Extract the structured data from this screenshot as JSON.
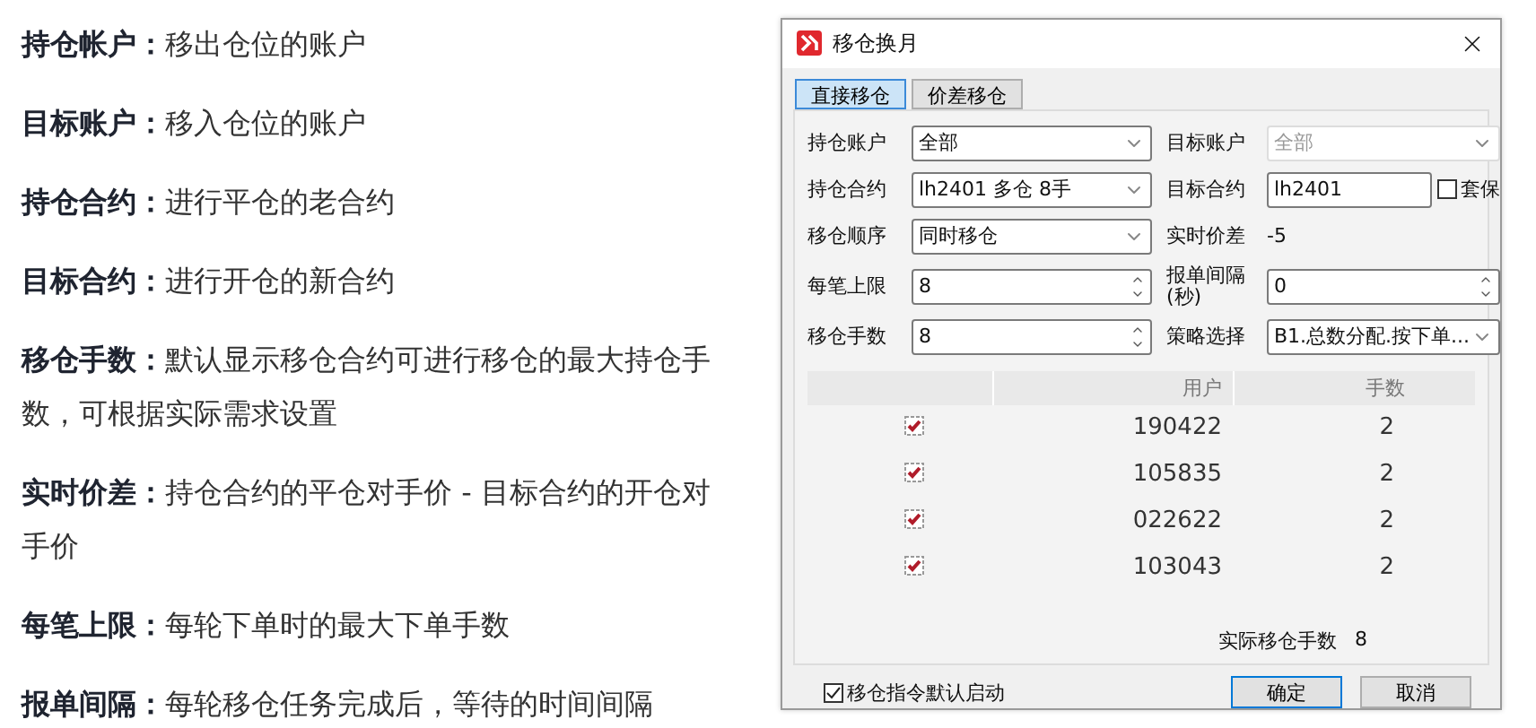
{
  "notes": [
    {
      "text": "**持仓帐户：**移出仓位的账户"
    },
    {
      "text": "**目标账户：**移入仓位的账户"
    },
    {
      "text": "**持仓合约：**进行平仓的老合约"
    },
    {
      "text": "**目标合约：**进行开仓的新合约"
    },
    {
      "text": "**移仓手数：**默认显示移仓合约可进行移仓的最大持仓手数，可根据实际需求设置"
    },
    {
      "text": "**实时价差：**持仓合约的平仓对手价 - 目标合约的开仓对手价"
    },
    {
      "text": "**每笔上限：**每轮下单时的最大下单手数"
    },
    {
      "text": "**报单间隔：**每轮移仓任务完成后，等待的时间间隔"
    }
  ],
  "dialog": {
    "title": "移仓换月",
    "tabs": [
      {
        "label": "直接移仓",
        "selected": true
      },
      {
        "label": "价差移仓",
        "selected": false
      }
    ],
    "fields": [
      {
        "label": "持仓账户",
        "kind": "select",
        "value": "全部"
      },
      {
        "label": "目标账户",
        "kind": "select",
        "value": "全部",
        "disabled": true
      },
      {
        "label": "持仓合约",
        "kind": "select",
        "value": "lh2401 多仓 8手"
      },
      {
        "label": "目标合约",
        "kind": "text",
        "value": "lh2401",
        "check": {
          "label": "套保",
          "checked": false
        }
      },
      {
        "label": "移仓顺序",
        "kind": "select",
        "value": "同时移仓"
      },
      {
        "label": "实时价差",
        "kind": "readout",
        "value": "-5"
      },
      {
        "label": "每笔上限",
        "kind": "spin",
        "value": "8"
      },
      {
        "label": "报单间隔(秒)",
        "kind": "spin",
        "value": "0"
      },
      {
        "label": "移仓手数",
        "kind": "spin",
        "value": "8"
      },
      {
        "label": "策略选择",
        "kind": "select",
        "value": "B1.总数分配.按下单..."
      }
    ],
    "table": {
      "columns": [
        "用户",
        "手数"
      ],
      "rows": [
        {
          "checked": true,
          "user": "190422",
          "qty": "2"
        },
        {
          "checked": true,
          "user": "105835",
          "qty": "2"
        },
        {
          "checked": true,
          "user": "022622",
          "qty": "2"
        },
        {
          "checked": true,
          "user": "103043",
          "qty": "2"
        }
      ]
    },
    "summary": {
      "label": "实际移仓手数",
      "value": "8"
    },
    "auto_start": {
      "label": "移仓指令默认启动",
      "checked": true
    },
    "buttons": [
      {
        "label": "确定",
        "default": true
      },
      {
        "label": "取消",
        "default": false
      }
    ]
  }
}
